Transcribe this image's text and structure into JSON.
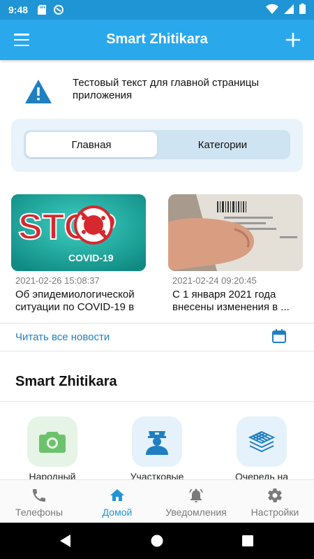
{
  "status_bar": {
    "time": "9:48",
    "icons": [
      "sd-card-icon",
      "data-saver-icon",
      "wifi-icon",
      "signal-icon",
      "battery-icon"
    ]
  },
  "app_bar": {
    "title": "Smart Zhitikara",
    "menu_icon": "hamburger-menu-icon",
    "add_icon": "plus-icon",
    "color": "#2aa8ec"
  },
  "notice": {
    "icon": "warning-icon",
    "text": "Тестовый текст для главной страницы приложения"
  },
  "segment": {
    "tabs": [
      {
        "label": "Главная",
        "active": true
      },
      {
        "label": "Категории",
        "active": false
      }
    ]
  },
  "news": [
    {
      "image": "stop-covid-19-image",
      "image_text": "STOP",
      "image_subtext": "COVID-19",
      "date": "2021-02-26 15:08:37",
      "title": "Об эпидемиологической ситуации по COVID-19 в ..."
    },
    {
      "image": "document-in-hand-image",
      "date": "2021-02-24 09:20:45",
      "title": "С 1 января 2021 года внесены изменения в ..."
    }
  ],
  "read_all": {
    "label": "Читать все новости",
    "icon": "calendar-icon"
  },
  "section": {
    "title": "Smart Zhitikara"
  },
  "services": [
    {
      "icon": "camera-icon",
      "label": "Народный",
      "tile_color": "#e6f4e6",
      "icon_color": "#6cc26c"
    },
    {
      "icon": "police-officer-icon",
      "label": "Участковые",
      "tile_color": "#e5f2fb",
      "icon_color": "#1f7fc1"
    },
    {
      "icon": "layers-queue-icon",
      "label": "Очередь на",
      "tile_color": "#e5f2fb",
      "icon_color": "#1f7fc1"
    }
  ],
  "bottom_nav": {
    "items": [
      {
        "label": "Телефоны",
        "icon": "phone-icon",
        "active": false
      },
      {
        "label": "Домой",
        "icon": "home-icon",
        "active": true
      },
      {
        "label": "Уведомления",
        "icon": "bell-icon",
        "active": false
      },
      {
        "label": "Настройки",
        "icon": "gear-icon",
        "active": false
      }
    ],
    "active_color": "#1f95d6",
    "inactive_color": "#7a7a7a"
  },
  "system_nav": {
    "buttons": [
      "back-icon",
      "home-circle-icon",
      "recents-icon"
    ]
  }
}
